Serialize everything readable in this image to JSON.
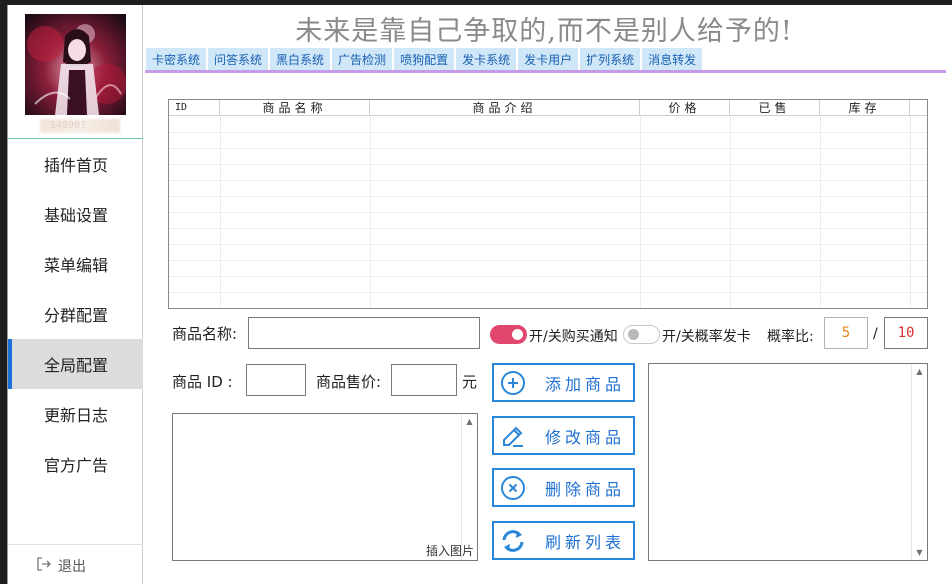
{
  "sidebar": {
    "uid": "14890?",
    "items": [
      {
        "label": "插件首页"
      },
      {
        "label": "基础设置"
      },
      {
        "label": "菜单编辑"
      },
      {
        "label": "分群配置"
      },
      {
        "label": "全局配置",
        "active": true
      },
      {
        "label": "更新日志"
      },
      {
        "label": "官方广告"
      }
    ],
    "logout_label": "退出",
    "logout_icon": "logout-icon"
  },
  "header": {
    "slogan": "未来是靠自己争取的,而不是别人给予的!"
  },
  "tabs": [
    "卡密系统",
    "问答系统",
    "黑白系统",
    "广告检测",
    "喷狗配置",
    "发卡系统",
    "发卡用户",
    "扩列系统",
    "消息转发"
  ],
  "table": {
    "columns": [
      "ID",
      "商品名称",
      "商品介绍",
      "价格",
      "已售",
      "库存"
    ]
  },
  "form": {
    "product_name_label": "商品名称:",
    "product_name_value": "",
    "purchase_notify_label": "开/关购买通知",
    "purchase_notify_on": true,
    "prob_card_label": "开/关概率发卡",
    "prob_card_on": false,
    "ratio_label": "概率比:",
    "ratio_numerator": "5",
    "ratio_separator": "/",
    "ratio_denominator": "10",
    "product_id_label": "商品 ID :",
    "product_id_value": "",
    "price_label": "商品售价:",
    "price_value": "",
    "price_unit": "元",
    "insert_image_label": "插入图片"
  },
  "actions": [
    {
      "label": "添加商品",
      "icon": "plus-circle-icon"
    },
    {
      "label": "修改商品",
      "icon": "edit-icon"
    },
    {
      "label": "删除商品",
      "icon": "delete-circle-icon"
    },
    {
      "label": "刷新列表",
      "icon": "refresh-icon"
    }
  ],
  "colors": {
    "accent_blue": "#2a86d8",
    "tab_bg": "#cfe7f7",
    "tab_underline": "#c79ae8",
    "toggle_on": "#e0466e",
    "numerator_color": "#e8891a",
    "denominator_color": "#d93030",
    "active_nav_bar": "#1a6ed8"
  }
}
